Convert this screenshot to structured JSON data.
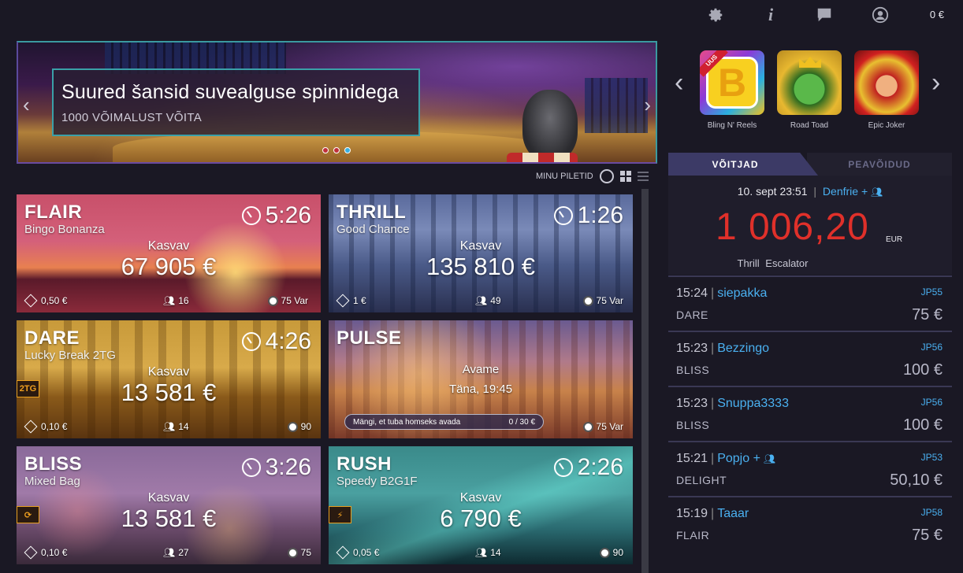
{
  "topbar": {
    "balance": "0 €",
    "icons": [
      "gear-icon",
      "info-icon",
      "chat-icon",
      "user-icon"
    ]
  },
  "banner": {
    "title": "Suured šansid suvealguse spinnidega",
    "subtitle": "1000 VÕIMALUST VÕITA",
    "prev": "‹",
    "next": "›"
  },
  "tickets": {
    "label": "MINU PILETID"
  },
  "rooms": [
    {
      "name": "FLAIR",
      "sub": "Bingo Bonanza",
      "timer": "5:26",
      "kasvav": "Kasvav",
      "pot": "67 905 €",
      "price": "0,50 €",
      "players": "16",
      "balls": "75 Var"
    },
    {
      "name": "THRILL",
      "sub": "Good Chance",
      "timer": "1:26",
      "kasvav": "Kasvav",
      "pot": "135 810 €",
      "price": "1 €",
      "players": "49",
      "balls": "75 Var"
    },
    {
      "name": "DARE",
      "sub": "Lucky Break 2TG",
      "timer": "4:26",
      "kasvav": "Kasvav",
      "pot": "13 581 €",
      "price": "0,10 €",
      "players": "14",
      "balls": "90",
      "tag": "2TG"
    },
    {
      "name": "PULSE",
      "opens": "Avame",
      "opens_time": "Täna, 19:45",
      "progress_text": "Mängi, et tuba homseks avada",
      "progress_value": "0 / 30 €",
      "balls": "75 Var"
    },
    {
      "name": "BLISS",
      "sub": "Mixed Bag",
      "timer": "3:26",
      "kasvav": "Kasvav",
      "pot": "13 581 €",
      "price": "0,10 €",
      "players": "27",
      "balls": "75"
    },
    {
      "name": "RUSH",
      "sub": "Speedy B2G1F",
      "timer": "2:26",
      "kasvav": "Kasvav",
      "pot": "6 790 €",
      "price": "0,05 €",
      "players": "14",
      "balls": "90"
    }
  ],
  "games": [
    {
      "name": "Bling N' Reels",
      "badge": "UUS",
      "letter": "B"
    },
    {
      "name": "Road Toad"
    },
    {
      "name": "Epic Joker"
    }
  ],
  "winners_tabs": {
    "active": "VÕITJAD",
    "inactive": "PEAVÕIDUD"
  },
  "top_winner": {
    "datetime": "10. sept 23:51",
    "separator": "|",
    "user": "Denfrie +",
    "amount": "1 006,20",
    "currency": "EUR",
    "game": "Thrill Escalator"
  },
  "winners": [
    {
      "time": "15:24",
      "user": "siepakka",
      "jp": "JP55",
      "room": "DARE",
      "amount": "75 €"
    },
    {
      "time": "15:23",
      "user": "Bezzingo",
      "jp": "JP56",
      "room": "BLISS",
      "amount": "100 €"
    },
    {
      "time": "15:23",
      "user": "Snuppa3333",
      "jp": "JP56",
      "room": "BLISS",
      "amount": "100 €"
    },
    {
      "time": "15:21",
      "user": "Popjo +",
      "jp": "JP53",
      "room": "DELIGHT",
      "amount": "50,10 €"
    },
    {
      "time": "15:19",
      "user": "Taaar",
      "jp": "JP58",
      "room": "FLAIR",
      "amount": "75 €"
    }
  ],
  "colors": {
    "accent": "#4ab0f0",
    "jackpot": "#e0302a",
    "tab": "#3c3a66",
    "bg": "#1a1824"
  }
}
